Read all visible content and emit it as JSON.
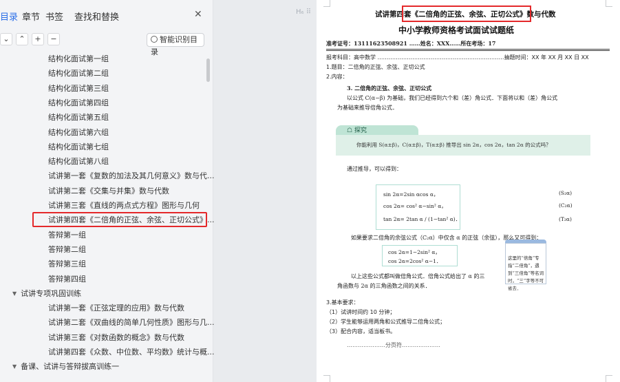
{
  "tabs": {
    "catalog": "目录",
    "chapter": "章节",
    "bookmark": "书签",
    "find_replace": "查找和替换"
  },
  "toolbar": {
    "collapse": "⌄",
    "expand": "⌃",
    "add": "+",
    "remove": "−",
    "smart_recognize": "智能识别目录"
  },
  "tree": [
    {
      "label": "结构化面试第一组",
      "level": 2
    },
    {
      "label": "结构化面试第二组",
      "level": 2
    },
    {
      "label": "结构化面试第三组",
      "level": 2
    },
    {
      "label": "结构化面试第四组",
      "level": 2
    },
    {
      "label": "结构化面试第五组",
      "level": 2
    },
    {
      "label": "结构化面试第六组",
      "level": 2
    },
    {
      "label": "结构化面试第七组",
      "level": 2
    },
    {
      "label": "结构化面试第八组",
      "level": 2
    },
    {
      "label": "试讲第一套《复数的加法及其几何意义》数与代...",
      "level": 2
    },
    {
      "label": "试讲第二套《交集与并集》数与代数",
      "level": 2
    },
    {
      "label": "试讲第三套《直线的两点式方程》图形与几何",
      "level": 2
    },
    {
      "label": "试讲第四套《二倍角的正弦、余弦、正切公式》...",
      "level": 2,
      "selected": true
    },
    {
      "label": "答辩第一组",
      "level": 2
    },
    {
      "label": "答辩第二组",
      "level": 2
    },
    {
      "label": "答辩第三组",
      "level": 2
    },
    {
      "label": "答辩第四组",
      "level": 2
    },
    {
      "label": "试讲专项巩固训练",
      "level": 1
    },
    {
      "label": "试讲第一套《正弦定理的应用》数与代数",
      "level": 2
    },
    {
      "label": "试讲第二套《双曲线的简单几何性质》图形与几...",
      "level": 2
    },
    {
      "label": "试讲第三套《对数函数的概念》数与代数",
      "level": 2
    },
    {
      "label": "试讲第四套《众数、中位数、平均数》统计与概...",
      "level": 2
    },
    {
      "label": "备课、试讲与答辩拔高训练一",
      "level": 1
    }
  ],
  "doc": {
    "title": "试讲第四套《二倍角的正弦、余弦、正切公式》数与代数",
    "subtitle": "中小学教师资格考试面试试题纸",
    "exam_line": "准考证号：13111623508921 ……姓名：XXX……所在考场：17",
    "subject_line": "报考科目：高中数学 ……………………………………………………………抽题时间：XX 年 XX 月 XX 日 XX",
    "item1": "1.题目：二倍角的正弦、余弦、正切公式",
    "item2": "2.内容：",
    "section_heading": "3. 二倍角的正弦、余弦、正切公式",
    "para1": "以公式 C(α−β) 为基础，我们已经得到六个和（差）角公式．下面将以和（差）角公式",
    "para1b": "为基础来推导倍角公式．",
    "explore_label": "探究",
    "explore_text": "你能利用 S(α±β)，C(α±β)，T(α±β) 推导出 sin 2α，cos 2α，tan 2α 的公式吗？",
    "derive": "通过推导，可以得到：",
    "f_sin": "sin 2α=2sin αcos α，",
    "f_cos": "cos 2α= cos² α−sin² α，",
    "f_tan": "tan 2α= 2tan α / (1−tan² α)．",
    "tag_s": "(S₂α)",
    "tag_c": "(C₂α)",
    "tag_t": "(T₂α)",
    "para2": "如果要求二倍角的余弦公式（C₂α）中仅含 α 的正弦（余弦），那么又可得到：",
    "f_cos2": "cos 2α=1−2sin² α，",
    "f_cos3": "cos 2α=2cos² α−1．",
    "para3": "以上这些公式都叫做倍角公式．倍角公式给出了 α 的三",
    "para3b": "角函数与 2α 的三角函数之间的关系．",
    "note": "这里的“倍角”专指“二倍角”，遇到“三倍角”等名词时，“三”字等不可省去．",
    "req_title": "3.基本要求：",
    "req1": "（1）试讲时间约 10 分钟；",
    "req2": "（2）学生能够运用两角和公式推导二倍角公式；",
    "req3": "（3）配合内容，适当板书。",
    "separator": "…………………分页符…………………"
  },
  "colors": {
    "accent": "#2a6ee8",
    "highlight": "#e4282a",
    "explore": "#bfe4d5"
  }
}
